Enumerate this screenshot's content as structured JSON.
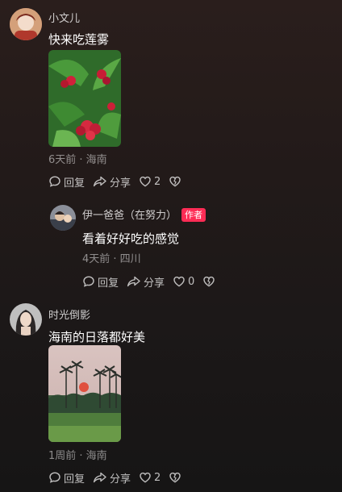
{
  "comments": [
    {
      "username": "小文儿",
      "text": "快来吃莲雾",
      "meta": "6天前 · 海南",
      "reply_label": "回复",
      "share_label": "分享",
      "like_count": "2"
    },
    {
      "username": "伊一爸爸（在努力）",
      "badge": "作者",
      "text": "看着好好吃的感觉",
      "meta": "4天前 · 四川",
      "reply_label": "回复",
      "share_label": "分享",
      "like_count": "0"
    },
    {
      "username": "时光倒影",
      "text": "海南的日落都好美",
      "meta": "1周前 · 海南",
      "reply_label": "回复",
      "share_label": "分享",
      "like_count": "2"
    }
  ],
  "colors": {
    "author_badge": "#fe2c55",
    "background": "#221a19"
  },
  "icons": [
    "comment-bubble-icon",
    "share-arrow-icon",
    "heart-icon",
    "broken-heart-icon"
  ]
}
